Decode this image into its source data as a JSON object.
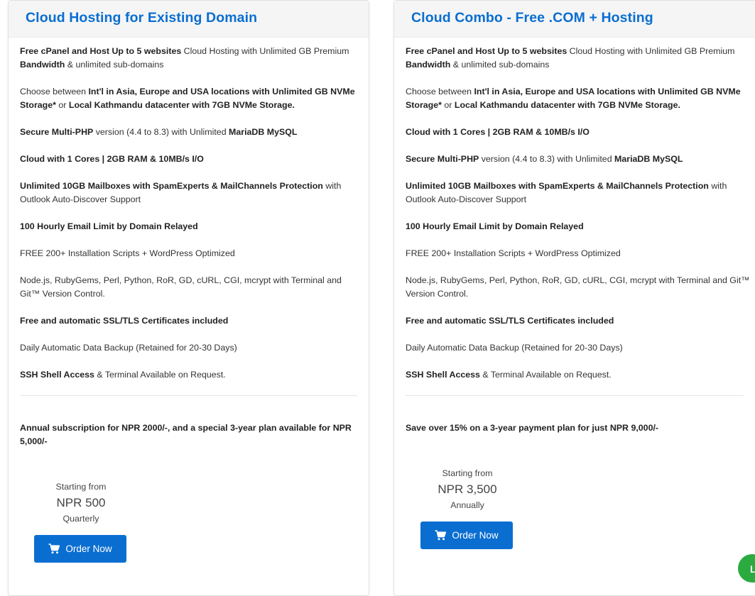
{
  "plans": [
    {
      "title": "Cloud Hosting for Existing Domain",
      "features": [
        [
          {
            "t": "Free cPanel and Host Up to 5 websites",
            "b": true
          },
          {
            "t": " Cloud Hosting with Unlimited GB Premium ",
            "b": false
          },
          {
            "t": "Bandwidth",
            "b": true
          },
          {
            "t": " & unlimited sub-domains",
            "b": false
          }
        ],
        [
          {
            "t": "Choose between ",
            "b": false
          },
          {
            "t": "Int'l in Asia, Europe and USA locations with Unlimited GB NVMe Storage*",
            "b": true
          },
          {
            "t": " or ",
            "b": false
          },
          {
            "t": "Local Kathmandu datacenter with 7GB NVMe Storage.",
            "b": true
          }
        ],
        [
          {
            "t": "Secure Multi-PHP",
            "b": true
          },
          {
            "t": " version (4.4 to 8.3) with Unlimited ",
            "b": false
          },
          {
            "t": "MariaDB MySQL",
            "b": true
          }
        ],
        [
          {
            "t": "Cloud with 1 Cores | 2GB RAM & 10MB/s I/O",
            "b": true
          }
        ],
        [
          {
            "t": "Unlimited 10GB Mailboxes with SpamExperts & MailChannels Protection",
            "b": true
          },
          {
            "t": " with Outlook Auto-Discover Support",
            "b": false
          }
        ],
        [
          {
            "t": "100 Hourly Email Limit by Domain Relayed",
            "b": true
          }
        ],
        [
          {
            "t": "FREE 200+ Installation Scripts + WordPress Optimized",
            "b": false
          }
        ],
        [
          {
            "t": "Node.js, RubyGems, Perl, Python, RoR, GD, cURL, CGI, mcrypt with Terminal and Git™ Version Control.",
            "b": false
          }
        ],
        [
          {
            "t": "Free and automatic SSL/TLS Certificates included",
            "b": true
          }
        ],
        [
          {
            "t": "Daily Automatic Data Backup (Retained for 20-30 Days)",
            "b": false
          }
        ],
        [
          {
            "t": "SSH Shell Access",
            "b": true
          },
          {
            "t": " & Terminal Available on Request.",
            "b": false
          }
        ]
      ],
      "promo": "Annual subscription for NPR 2000/-, and a special 3-year plan available for NPR 5,000/-",
      "price": {
        "label": "Starting from",
        "amount": "NPR 500",
        "period": "Quarterly"
      },
      "order_label": "Order Now"
    },
    {
      "title": "Cloud Combo - Free .COM + Hosting",
      "features": [
        [
          {
            "t": "Free cPanel and Host Up to 5 websites",
            "b": true
          },
          {
            "t": " Cloud Hosting with Unlimited GB Premium ",
            "b": false
          },
          {
            "t": "Bandwidth",
            "b": true
          },
          {
            "t": " & unlimited sub-domains",
            "b": false
          }
        ],
        [
          {
            "t": "Choose between ",
            "b": false
          },
          {
            "t": "Int'l in Asia, Europe and USA locations with Unlimited GB NVMe Storage*",
            "b": true
          },
          {
            "t": " or ",
            "b": false
          },
          {
            "t": "Local Kathmandu datacenter with 7GB NVMe Storage.",
            "b": true
          }
        ],
        [
          {
            "t": "Cloud with 1 Cores | 2GB RAM & 10MB/s I/O",
            "b": true
          }
        ],
        [
          {
            "t": "Secure Multi-PHP",
            "b": true
          },
          {
            "t": " version (4.4 to 8.3) with Unlimited ",
            "b": false
          },
          {
            "t": "MariaDB MySQL",
            "b": true
          }
        ],
        [
          {
            "t": "Unlimited 10GB Mailboxes with SpamExperts & MailChannels Protection",
            "b": true
          },
          {
            "t": " with Outlook Auto-Discover Support",
            "b": false
          }
        ],
        [
          {
            "t": "100 Hourly Email Limit by Domain Relayed",
            "b": true
          }
        ],
        [
          {
            "t": "FREE 200+ Installation Scripts + WordPress Optimized",
            "b": false
          }
        ],
        [
          {
            "t": "Node.js, RubyGems, Perl, Python, RoR, GD, cURL, CGI, mcrypt with Terminal and Git™ Version Control.",
            "b": false
          }
        ],
        [
          {
            "t": "Free and automatic SSL/TLS Certificates included",
            "b": true
          }
        ],
        [
          {
            "t": "Daily Automatic Data Backup (Retained for 20-30 Days)",
            "b": false
          }
        ],
        [
          {
            "t": "SSH Shell Access",
            "b": true
          },
          {
            "t": " & Terminal Available on Request.",
            "b": false
          }
        ]
      ],
      "promo": "Save over 15% on a 3-year payment plan for just NPR 9,000/-",
      "price": {
        "label": "Starting from",
        "amount": "NPR 3,500",
        "period": "Annually"
      },
      "order_label": "Order Now"
    }
  ],
  "chat_widget": {
    "text": "L",
    "color": "#2bab3f"
  },
  "colors": {
    "accent": "#0a6ed1",
    "header_bg": "#f5f5f5"
  },
  "icons": {
    "order_button": "shopping-cart-icon"
  }
}
